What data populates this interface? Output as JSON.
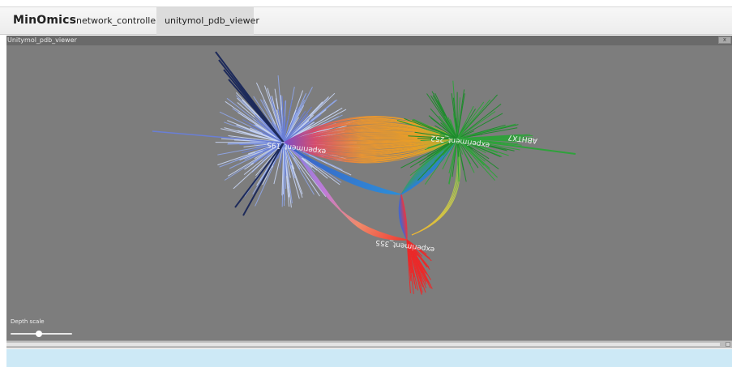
{
  "app": {
    "brand": "MinOmics",
    "tabs": [
      {
        "label": "network_controller",
        "active": false
      },
      {
        "label": "unitymol_pdb_viewer",
        "active": true
      }
    ]
  },
  "viewer": {
    "title": "Unitymol_pdb_viewer",
    "close_label": "x",
    "depth_scale": {
      "label": "Depth scale",
      "value": 0.45
    },
    "node_labels": [
      "experiment_195",
      "experiment_252",
      "experiment_355",
      "ABHTX7"
    ]
  },
  "colors": {
    "viewer_background": "#7d7d7d",
    "cluster_blue": "#6a7fd6",
    "cluster_green": "#2fa23b",
    "cluster_red": "#ea2a2a",
    "cluster_orange": "#f1962a",
    "cluster_light": "#c9d6f5",
    "footer_strip": "#cde9f6"
  }
}
